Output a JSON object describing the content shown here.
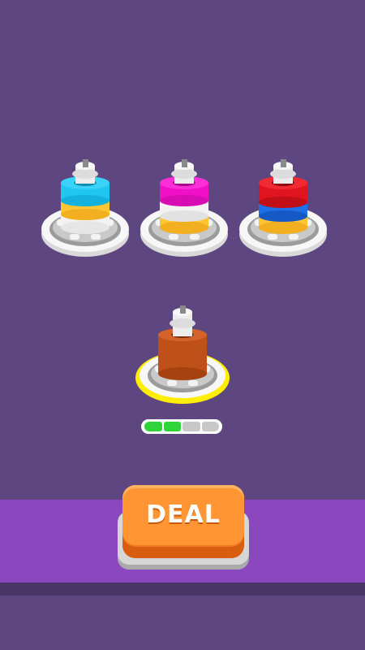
{
  "colors": {
    "background": "#5e4680",
    "bottom_bar": "#8b47bd",
    "progress_fill": "#2fd43b",
    "highlight_ring": "#ffee00",
    "deal_button": "#ff9533"
  },
  "spools": [
    {
      "name": "spool-1",
      "rings": [
        "white",
        "yellow",
        "cyan"
      ]
    },
    {
      "name": "spool-2",
      "rings": [
        "yellow",
        "white",
        "magenta"
      ]
    },
    {
      "name": "spool-3",
      "rings": [
        "yellow",
        "blue",
        "red"
      ]
    },
    {
      "name": "spool-selected",
      "rings": [
        "brown"
      ],
      "highlighted": true
    }
  ],
  "progress": {
    "filled": 2,
    "total": 4
  },
  "deal_button": {
    "label": "DEAL"
  }
}
